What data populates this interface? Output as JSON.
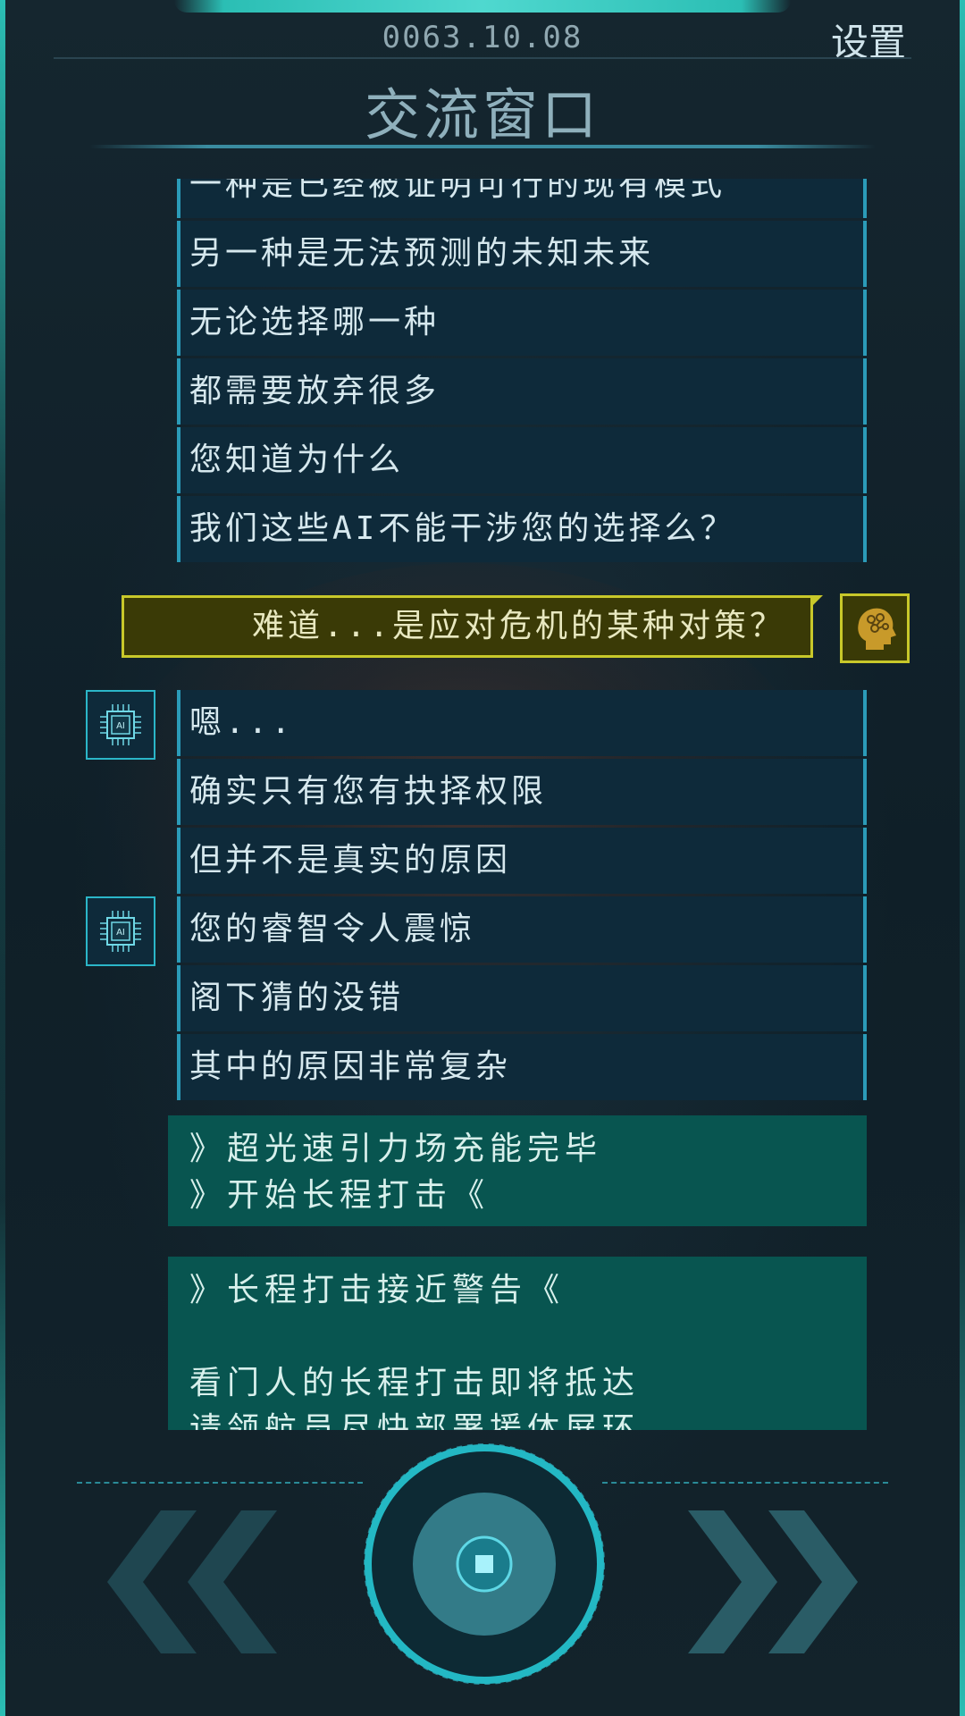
{
  "header": {
    "date": "0063.10.08",
    "settings_label": "设置",
    "title": "交流窗口"
  },
  "messages_top": [
    "一种是已经被证明可行的现有模式",
    "另一种是无法预测的未知未来",
    "无论选择哪一种",
    "都需要放弃很多",
    "您知道为什么",
    "我们这些AI不能干涉您的选择么？"
  ],
  "player_message": "难道...是应对危机的某种对策？",
  "messages_group1": [
    "嗯...",
    "确实只有您有抉择权限",
    "但并不是真实的原因"
  ],
  "messages_group2": [
    "您的睿智令人震惊",
    "阁下猜的没错",
    "其中的原因非常复杂"
  ],
  "notice1": [
    "》超光速引力场充能完毕",
    "》开始长程打击《"
  ],
  "notice2": [
    "》长程打击接近警告《",
    "",
    "看门人的长程打击即将抵达",
    "请领航员尽快部署援体屏环"
  ],
  "ai_badge_text": "AI",
  "colors": {
    "accent": "#2bbeb4",
    "message_bg": "#0e2a3a",
    "player_bg": "#3a3a06",
    "player_border": "#c8c82a",
    "notice_bg": "#085550"
  },
  "icons": {
    "back": "double-chevron-left-icon",
    "forward": "double-chevron-right-icon",
    "center": "stop-circle-icon",
    "ai": "chip-ai-icon",
    "player": "brain-head-icon"
  }
}
